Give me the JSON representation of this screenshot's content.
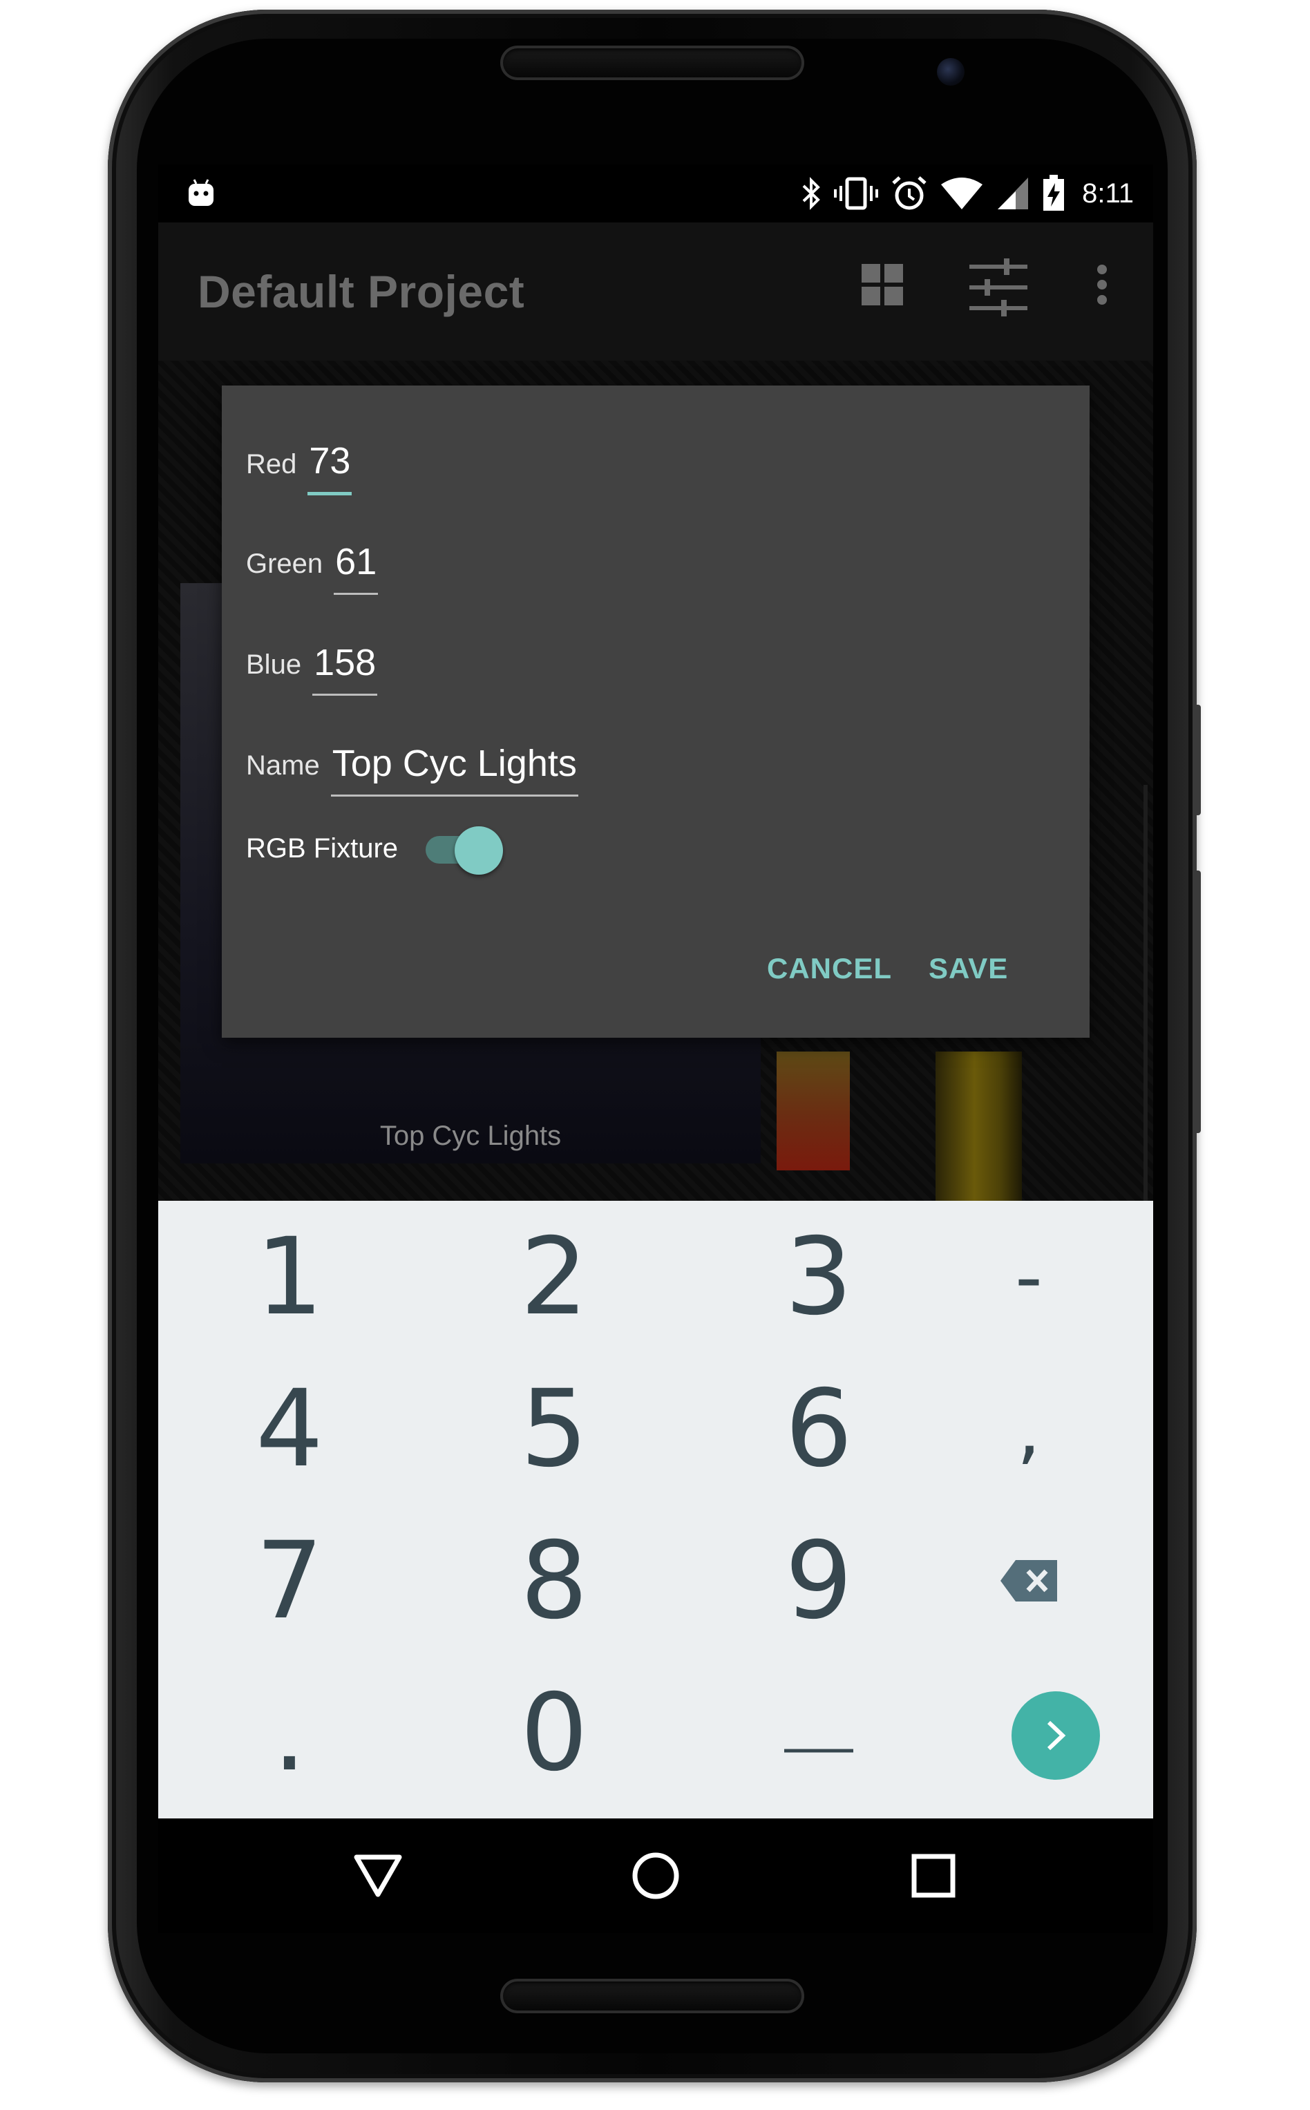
{
  "status_bar": {
    "time": "8:11",
    "icons": [
      "android-icon",
      "bluetooth-icon",
      "vibrate-icon",
      "alarm-icon",
      "wifi-icon",
      "signal-icon",
      "battery-charging-icon"
    ]
  },
  "app_bar": {
    "title": "Default Project",
    "actions": [
      "grid-view-icon",
      "sliders-icon",
      "more-vert-icon"
    ]
  },
  "fixture": {
    "label": "Top Cyc Lights"
  },
  "dialog": {
    "fields": {
      "red": {
        "label": "Red",
        "value": "73",
        "focused": true
      },
      "green": {
        "label": "Green",
        "value": "61"
      },
      "blue": {
        "label": "Blue",
        "value": "158"
      },
      "name": {
        "label": "Name",
        "value": "Top Cyc Lights"
      }
    },
    "rgb_switch": {
      "label": "RGB Fixture",
      "checked": true
    },
    "buttons": {
      "cancel": "CANCEL",
      "save": "SAVE"
    }
  },
  "keyboard": {
    "rows": [
      [
        "1",
        "2",
        "3",
        "-"
      ],
      [
        "4",
        "5",
        "6",
        ","
      ],
      [
        "7",
        "8",
        "9",
        "backspace-icon"
      ],
      [
        ".",
        "0",
        "space-bar-icon",
        "enter-icon"
      ]
    ],
    "accent_color": "#43b3a7"
  },
  "nav_bar": {
    "buttons": [
      "back-icon",
      "home-icon",
      "recents-icon"
    ]
  },
  "colors": {
    "accent": "#80cbc4",
    "dialog_bg": "#424242",
    "keyboard_bg": "#eceff1"
  }
}
